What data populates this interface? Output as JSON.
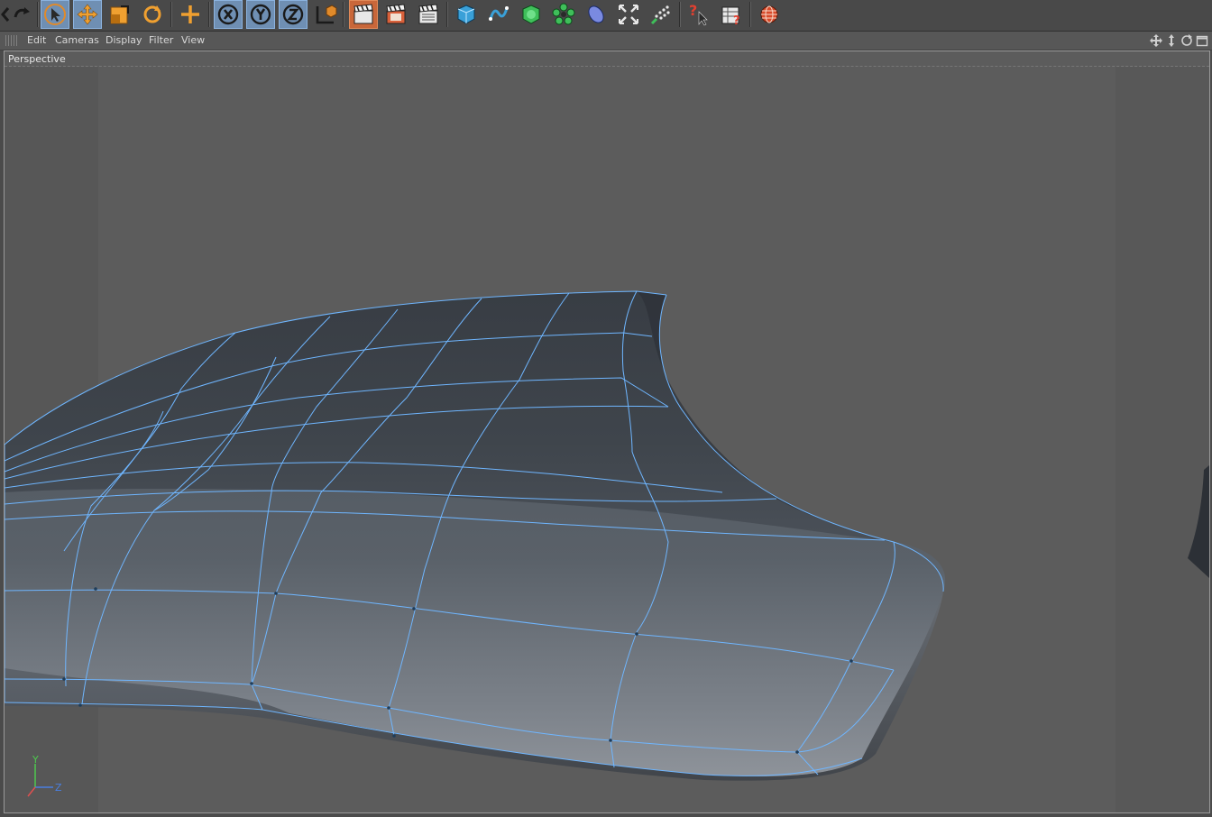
{
  "toolbar": {
    "buttons": [
      {
        "name": "redo-button",
        "icon": "redo-arrow-icon"
      },
      {
        "name": "live-selection-tool",
        "icon": "cursor-arrow-icon",
        "active": true
      },
      {
        "name": "move-tool",
        "icon": "move-arrows-icon",
        "active": true
      },
      {
        "name": "scale-tool",
        "icon": "scale-icon"
      },
      {
        "name": "rotate-tool",
        "icon": "rotate-icon"
      },
      {
        "name": "recent-tools",
        "icon": "plus-cross-icon"
      },
      {
        "name": "x-axis-lock",
        "icon": "x-axis-icon",
        "active": true
      },
      {
        "name": "y-axis-lock",
        "icon": "y-axis-icon",
        "active": true
      },
      {
        "name": "z-axis-lock",
        "icon": "z-axis-icon",
        "active": true
      },
      {
        "name": "coordinate-system",
        "icon": "coordinate-system-icon"
      },
      {
        "name": "render-view",
        "icon": "clapper-icon",
        "active": true
      },
      {
        "name": "render-to-picture-viewer",
        "icon": "clapper-red-icon"
      },
      {
        "name": "render-settings",
        "icon": "clapper-settings-icon"
      },
      {
        "name": "add-cube",
        "icon": "cube-icon"
      },
      {
        "name": "add-spline",
        "icon": "spline-icon"
      },
      {
        "name": "add-subdivision",
        "icon": "subdivision-icon"
      },
      {
        "name": "add-array",
        "icon": "array-flower-icon"
      },
      {
        "name": "add-deformer",
        "icon": "deformer-icon"
      },
      {
        "name": "add-environment",
        "icon": "environment-icon"
      },
      {
        "name": "add-particles",
        "icon": "particles-icon"
      },
      {
        "name": "help-pointer",
        "icon": "help-pointer-icon"
      },
      {
        "name": "help-table",
        "icon": "help-table-icon"
      },
      {
        "name": "web-button",
        "icon": "globe-icon"
      }
    ]
  },
  "menu": {
    "items": [
      "Edit",
      "Cameras",
      "Display",
      "Filter",
      "View"
    ]
  },
  "viewport": {
    "label": "Perspective",
    "axis": {
      "y": "Y",
      "z": "Z"
    }
  },
  "colors": {
    "viewport_bg": "#5c5c5c",
    "wire": "#6fb6ff",
    "toolbar_active": "#6f8fb3",
    "axis_y": "#4ec94e",
    "axis_z": "#4a7fe0",
    "axis_x": "#e05050"
  }
}
